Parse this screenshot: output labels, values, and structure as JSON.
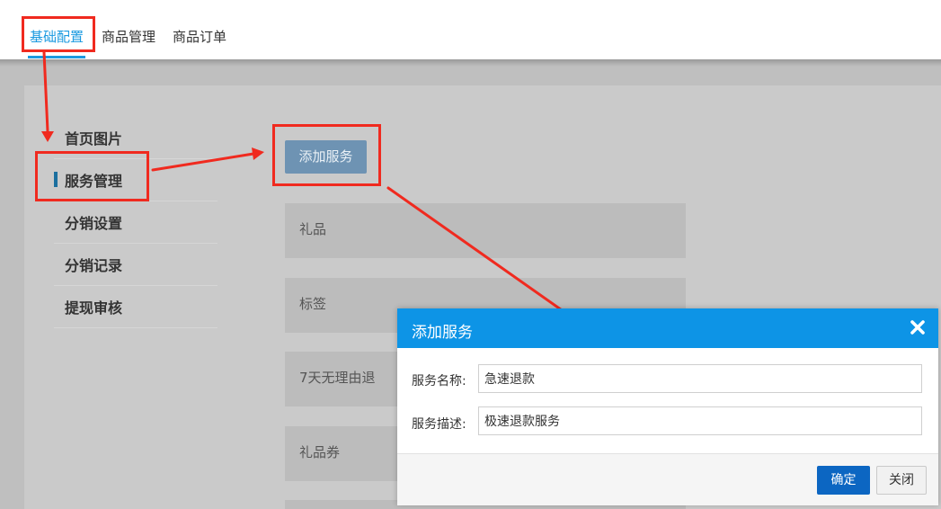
{
  "nav": {
    "tabs": [
      {
        "label": "基础配置"
      },
      {
        "label": "商品管理"
      },
      {
        "label": "商品订单"
      }
    ]
  },
  "sidebar": {
    "items": [
      {
        "label": "首页图片"
      },
      {
        "label": "服务管理"
      },
      {
        "label": "分销设置"
      },
      {
        "label": "分销记录"
      },
      {
        "label": "提现审核"
      }
    ]
  },
  "main": {
    "add_label": "添加服务",
    "services": [
      "礼品",
      "标签",
      "7天无理由退",
      "礼品券"
    ]
  },
  "modal": {
    "title": "添加服务",
    "fields": [
      {
        "label": "服务名称:",
        "value": "急速退款"
      },
      {
        "label": "服务描述:",
        "value": "极速退款服务"
      }
    ],
    "ok_label": "确定",
    "close_label": "关闭"
  },
  "colors": {
    "accent": "#1b9ae0",
    "modal_header": "#0d94e6",
    "primary_button": "#0c66c2",
    "annotation": "#f02a1f"
  }
}
